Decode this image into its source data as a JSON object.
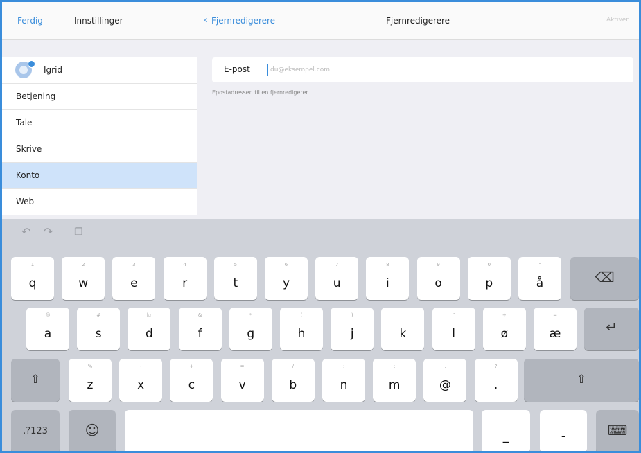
{
  "accent_color": "#3a8ddb",
  "left_header": {
    "done_label": "Ferdig",
    "title": "Innstillinger"
  },
  "right_header": {
    "back_label": "Fjernredigerere",
    "title": "Fjernredigerere",
    "action_label": "Aktiver"
  },
  "sidebar": {
    "items": [
      {
        "label": "Igrid",
        "icon": "user-avatar-icon"
      },
      {
        "label": "Betjening"
      },
      {
        "label": "Tale"
      },
      {
        "label": "Skrive"
      },
      {
        "label": "Konto",
        "selected": true
      },
      {
        "label": "Web"
      }
    ]
  },
  "email_form": {
    "label": "E-post",
    "value": "",
    "placeholder": "du@eksempel.com",
    "hint": "Epostadressen til en fjernredigerer."
  },
  "keyboard": {
    "toolbar_icons": [
      "undo-icon",
      "redo-icon",
      "paste-icon"
    ],
    "row1": [
      {
        "main": "q",
        "sub": "1"
      },
      {
        "main": "w",
        "sub": "2"
      },
      {
        "main": "e",
        "sub": "3"
      },
      {
        "main": "r",
        "sub": "4"
      },
      {
        "main": "t",
        "sub": "5"
      },
      {
        "main": "y",
        "sub": "6"
      },
      {
        "main": "u",
        "sub": "7"
      },
      {
        "main": "i",
        "sub": "8"
      },
      {
        "main": "o",
        "sub": "9"
      },
      {
        "main": "p",
        "sub": "0"
      },
      {
        "main": "å",
        "sub": "\""
      }
    ],
    "row2": [
      {
        "main": "a",
        "sub": "@"
      },
      {
        "main": "s",
        "sub": "#"
      },
      {
        "main": "d",
        "sub": "kr"
      },
      {
        "main": "f",
        "sub": "&"
      },
      {
        "main": "g",
        "sub": "*"
      },
      {
        "main": "h",
        "sub": "("
      },
      {
        "main": "j",
        "sub": ")"
      },
      {
        "main": "k",
        "sub": "'"
      },
      {
        "main": "l",
        "sub": "\""
      },
      {
        "main": "ø",
        "sub": "+"
      },
      {
        "main": "æ",
        "sub": "="
      }
    ],
    "row3": [
      {
        "main": "z",
        "sub": "%"
      },
      {
        "main": "x",
        "sub": "-"
      },
      {
        "main": "c",
        "sub": "+"
      },
      {
        "main": "v",
        "sub": "="
      },
      {
        "main": "b",
        "sub": "/"
      },
      {
        "main": "n",
        "sub": ";"
      },
      {
        "main": "m",
        "sub": ":"
      },
      {
        "main": "@",
        "sub": ","
      },
      {
        "main": ".",
        "sub": "?"
      }
    ],
    "row4": {
      "numbers_label": ".?123",
      "underscore_label": "_",
      "dash_label": "-"
    },
    "special": {
      "backspace": "⌫",
      "return": "↵",
      "shift": "⇧",
      "emoji": "☺",
      "hide": "⌨"
    }
  }
}
